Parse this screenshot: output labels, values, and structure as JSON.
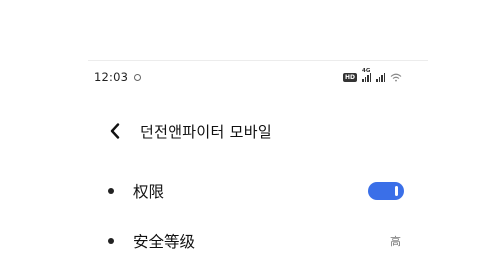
{
  "status_bar": {
    "time": "12:03",
    "network_type": "4G",
    "hd_label": "HD",
    "icons": [
      "sync-icon",
      "hd-icon",
      "signal-icon",
      "signal-icon",
      "wifi-icon"
    ]
  },
  "header": {
    "title": "던전앤파이터 모바일",
    "back_icon": "chevron-left-icon"
  },
  "settings": {
    "permissions": {
      "label": "权限",
      "toggle_on": true
    },
    "security_level": {
      "label": "安全等级",
      "value": "高"
    }
  },
  "colors": {
    "accent": "#3a6fe8",
    "background": "#ffffff",
    "text": "#111111",
    "secondary_text": "#777777"
  }
}
